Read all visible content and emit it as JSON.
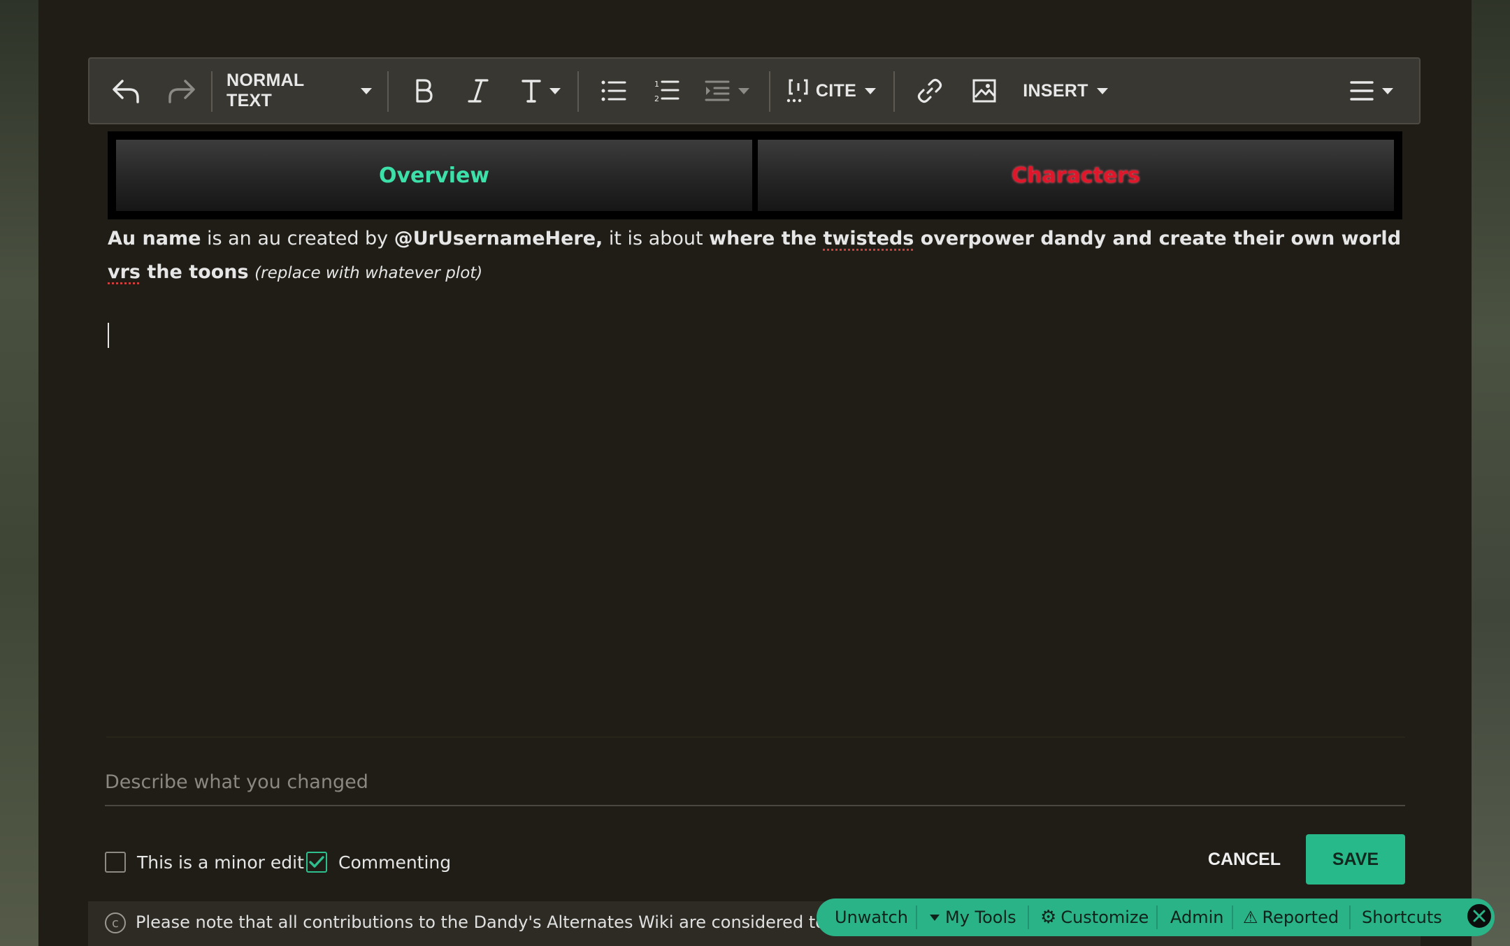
{
  "toolbar": {
    "paragraph_format": "NORMAL TEXT",
    "cite_label": "CITE",
    "insert_label": "INSERT"
  },
  "tabs": {
    "overview": "Overview",
    "characters": "Characters"
  },
  "content": {
    "au_name": "Au name",
    "text1": " is an au created by ",
    "username": "@UrUsernameHere,",
    "text2": " it is about ",
    "plot_a": "where the ",
    "plot_twisteds": "twisteds",
    "plot_b": " overpower dandy and create their own world ",
    "plot_vrs": "vrs",
    "plot_c": " the toons",
    "note": "(replace with whatever plot)"
  },
  "summary": {
    "placeholder": "Describe what you changed"
  },
  "options": {
    "minor_edit_label": "This is a minor edit",
    "minor_edit_checked": false,
    "commenting_label": "Commenting",
    "commenting_checked": true
  },
  "actions": {
    "cancel": "CANCEL",
    "save": "SAVE"
  },
  "notice": {
    "text": "Please note that all contributions to the Dandy's Alternates Wiki are considered to be rel"
  },
  "bottom_toolbar": {
    "unwatch": "Unwatch",
    "my_tools": "My Tools",
    "customize": "Customize",
    "admin": "Admin",
    "reported": "Reported",
    "shortcuts": "Shortcuts"
  },
  "colors": {
    "accent": "#27b98a",
    "overview_tab": "#3de0a8",
    "characters_tab": "#e0162b",
    "background": "#1f1d16"
  }
}
